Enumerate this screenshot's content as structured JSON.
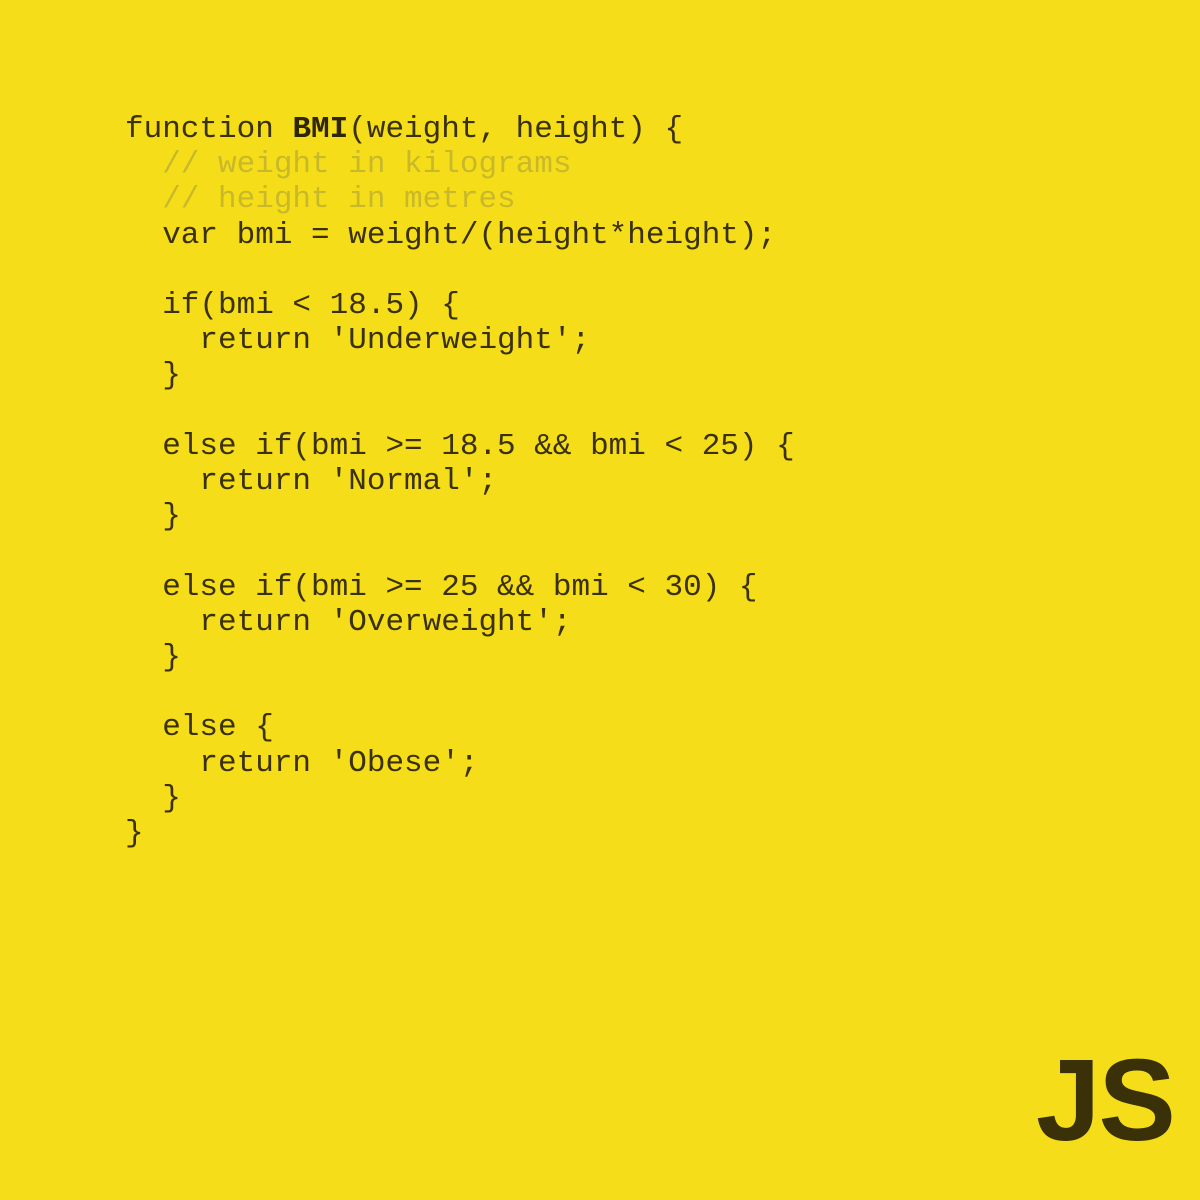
{
  "card": {
    "background_color": "#F5DE19",
    "code_color": "#3B3109",
    "comment_color": "#C9B92A",
    "logo_color": "#3B3109"
  },
  "logo": {
    "text": "JS",
    "name": "javascript-logo"
  },
  "code": {
    "language": "javascript",
    "function_name": "BMI",
    "lines": [
      {
        "id": "line-1",
        "segments": [
          {
            "text": "function ",
            "style": "plain"
          },
          {
            "text": "BMI",
            "style": "bold"
          },
          {
            "text": "(weight, height) {",
            "style": "plain"
          }
        ]
      },
      {
        "id": "line-2",
        "segments": [
          {
            "text": "  // weight in kilograms",
            "style": "comment"
          }
        ]
      },
      {
        "id": "line-3",
        "segments": [
          {
            "text": "  // height in metres",
            "style": "comment"
          }
        ]
      },
      {
        "id": "line-4",
        "segments": [
          {
            "text": "  var bmi = weight/(height*height);",
            "style": "plain"
          }
        ]
      },
      {
        "id": "line-5",
        "segments": [
          {
            "text": "",
            "style": "plain"
          }
        ]
      },
      {
        "id": "line-6",
        "segments": [
          {
            "text": "  if(bmi < 18.5) {",
            "style": "plain"
          }
        ]
      },
      {
        "id": "line-7",
        "segments": [
          {
            "text": "    return 'Underweight';",
            "style": "plain"
          }
        ]
      },
      {
        "id": "line-8",
        "segments": [
          {
            "text": "  }",
            "style": "plain"
          }
        ]
      },
      {
        "id": "line-9",
        "segments": [
          {
            "text": "",
            "style": "plain"
          }
        ]
      },
      {
        "id": "line-10",
        "segments": [
          {
            "text": "  else if(bmi >= 18.5 && bmi < 25) {",
            "style": "plain"
          }
        ]
      },
      {
        "id": "line-11",
        "segments": [
          {
            "text": "    return 'Normal';",
            "style": "plain"
          }
        ]
      },
      {
        "id": "line-12",
        "segments": [
          {
            "text": "  }",
            "style": "plain"
          }
        ]
      },
      {
        "id": "line-13",
        "segments": [
          {
            "text": "",
            "style": "plain"
          }
        ]
      },
      {
        "id": "line-14",
        "segments": [
          {
            "text": "  else if(bmi >= 25 && bmi < 30) {",
            "style": "plain"
          }
        ]
      },
      {
        "id": "line-15",
        "segments": [
          {
            "text": "    return 'Overweight';",
            "style": "plain"
          }
        ]
      },
      {
        "id": "line-16",
        "segments": [
          {
            "text": "  }",
            "style": "plain"
          }
        ]
      },
      {
        "id": "line-17",
        "segments": [
          {
            "text": "",
            "style": "plain"
          }
        ]
      },
      {
        "id": "line-18",
        "segments": [
          {
            "text": "  else {",
            "style": "plain"
          }
        ]
      },
      {
        "id": "line-19",
        "segments": [
          {
            "text": "    return 'Obese';",
            "style": "plain"
          }
        ]
      },
      {
        "id": "line-20",
        "segments": [
          {
            "text": "  }",
            "style": "plain"
          }
        ]
      },
      {
        "id": "line-21",
        "segments": [
          {
            "text": "}",
            "style": "plain"
          }
        ]
      }
    ]
  }
}
